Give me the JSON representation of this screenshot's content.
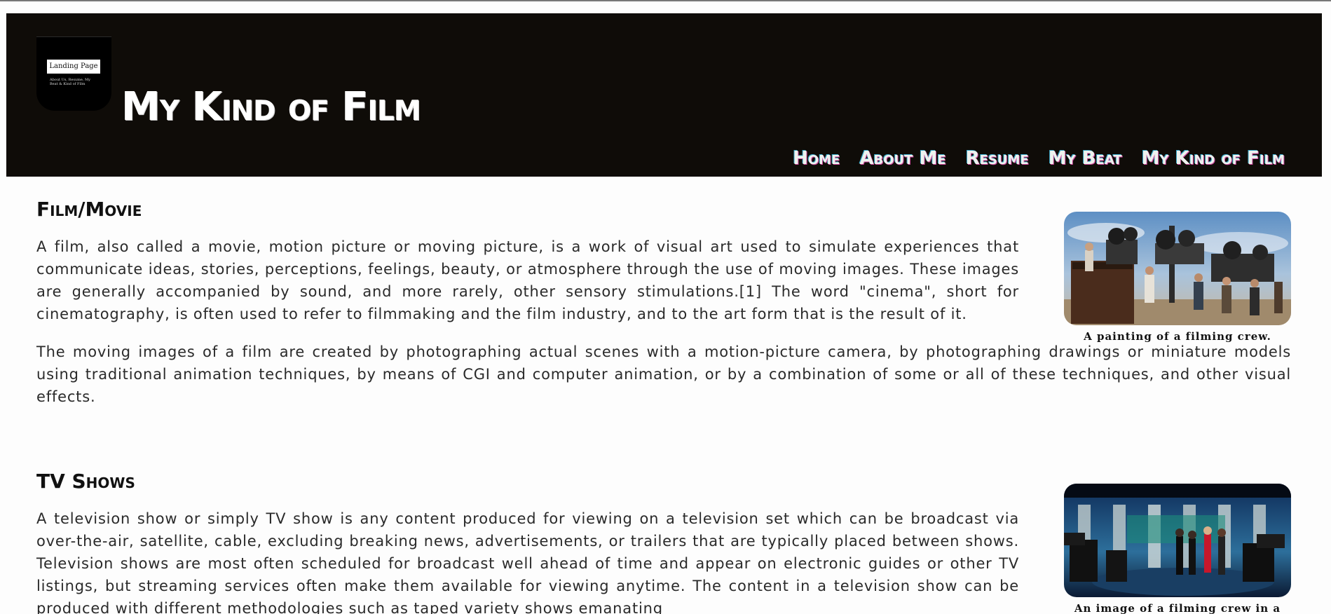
{
  "header": {
    "logo_label": "Landing Page",
    "logo_sub": "About Us, Resume, My Beat & Kind of Film",
    "title": "My Kind of Film",
    "nav": [
      "Home",
      "About Me",
      "Resume",
      "My Beat",
      "My Kind of Film"
    ]
  },
  "sections": [
    {
      "heading": "Film/Movie",
      "paragraphs": [
        "A film, also called a movie, motion picture or moving picture, is a work of visual art used to simulate experiences that communicate ideas, stories, perceptions, feelings, beauty, or atmosphere through the use of moving images. These images are generally accompanied by sound, and more rarely, other sensory stimulations.[1] The word \"cinema\", short for cinematography, is often used to refer to filmmaking and the film industry, and to the art form that is the result of it.",
        "The moving images of a film are created by photographing actual scenes with a motion-picture camera, by photographing drawings or miniature models using traditional animation techniques, by means of CGI and computer animation, or by a combination of some or all of these techniques, and other visual effects."
      ],
      "figure_caption": "A painting of a filming crew."
    },
    {
      "heading": "TV Shows",
      "paragraphs": [
        "A television show or simply TV show is any content produced for viewing on a television set which can be broadcast via over-the-air, satellite, cable, excluding breaking news, advertisements, or trailers that are typically placed between shows. Television shows are most often scheduled for broadcast well ahead of time and appear on electronic guides or other TV listings, but streaming services often make them available for viewing anytime. The content in a television show can be produced with different methodologies such as taped variety shows emanating"
      ],
      "figure_caption": "An image of a filming crew in a set"
    }
  ]
}
